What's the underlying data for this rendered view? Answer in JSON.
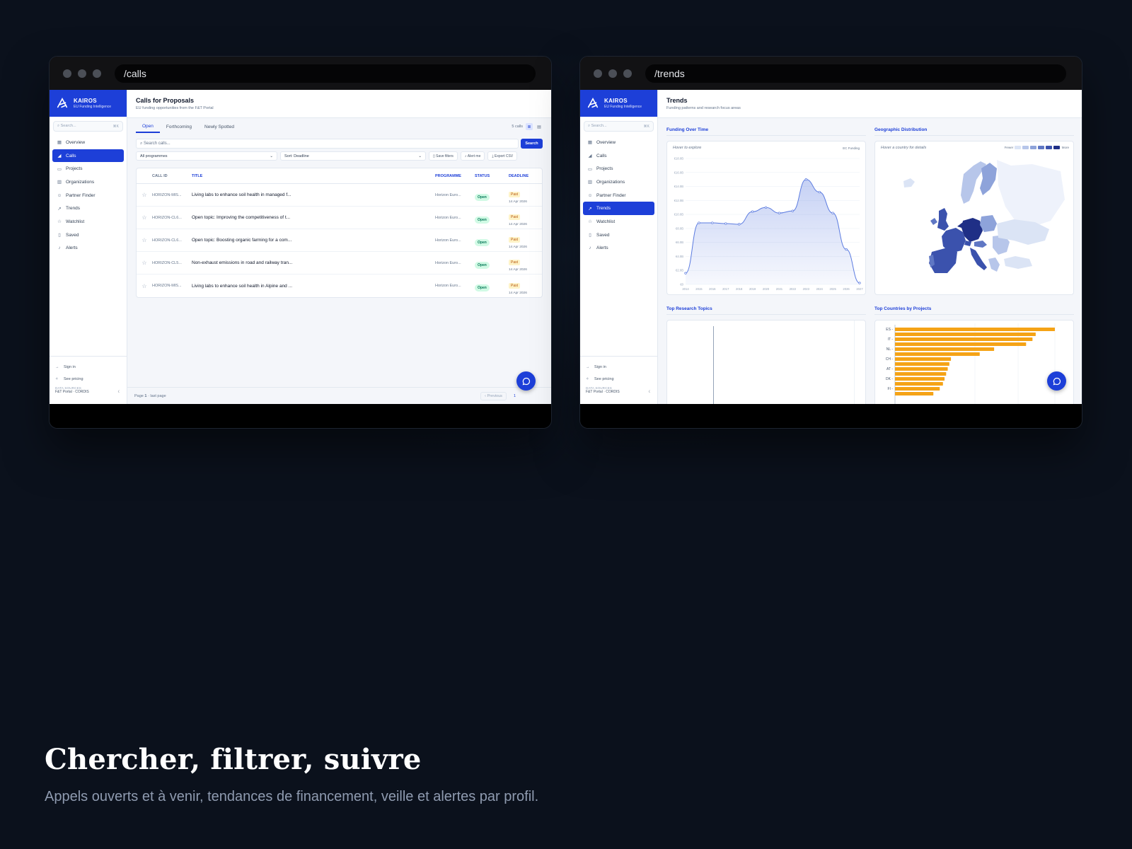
{
  "windows": {
    "calls": {
      "url": "/calls"
    },
    "trends": {
      "url": "/trends"
    }
  },
  "app": {
    "brand_name": "KAIROS",
    "brand_tagline": "EU Funding Intelligence",
    "search_placeholder": "Search...",
    "search_shortcut": "⌘K",
    "nav": [
      {
        "label": "Overview",
        "icon": "grid-icon"
      },
      {
        "label": "Calls",
        "icon": "megaphone-icon"
      },
      {
        "label": "Projects",
        "icon": "folder-icon"
      },
      {
        "label": "Organizations",
        "icon": "building-icon"
      },
      {
        "label": "Partner Finder",
        "icon": "users-icon"
      },
      {
        "label": "Trends",
        "icon": "trending-up-icon"
      },
      {
        "label": "Watchlist",
        "icon": "star-icon"
      },
      {
        "label": "Saved",
        "icon": "bookmark-icon"
      },
      {
        "label": "Alerts",
        "icon": "bell-icon"
      }
    ],
    "sign_in": "Sign in",
    "see_pricing": "See pricing",
    "data_sources_label": "DATA SOURCES",
    "data_sources_value": "F&T Portal · CORDIS",
    "accent": "#1d3fd8"
  },
  "calls_page": {
    "title": "Calls for Proposals",
    "subtitle": "EU funding opportunities from the F&T Portal",
    "tabs": [
      "Open",
      "Forthcoming",
      "Newly Spotted"
    ],
    "count": "5 calls",
    "search_placeholder": "Search calls...",
    "search_button": "Search",
    "programme_select": "All programmes",
    "sort_select": "Sort: Deadline",
    "save_filters": "Save filters",
    "alert_me": "Alert me",
    "export_csv": "Export CSV",
    "columns": [
      "CALL ID",
      "TITLE",
      "PROGRAMME",
      "STATUS",
      "DEADLINE"
    ],
    "rows": [
      {
        "id": "HORIZON-MIS...",
        "title": "Living labs to enhance soil health in managed f...",
        "programme": "Horizon Euro...",
        "status": "Open",
        "deadline_tag": "Past",
        "deadline": "14 Apr 2026"
      },
      {
        "id": "HORIZON-CL6...",
        "title": "Open topic: Improving the competitiveness of t...",
        "programme": "Horizon Euro...",
        "status": "Open",
        "deadline_tag": "Past",
        "deadline": "14 Apr 2026"
      },
      {
        "id": "HORIZON-CL6...",
        "title": "Open topic: Boosting organic farming for a com...",
        "programme": "Horizon Euro...",
        "status": "Open",
        "deadline_tag": "Past",
        "deadline": "14 Apr 2026"
      },
      {
        "id": "HORIZON-CL5...",
        "title": "Non-exhaust emissions in road and railway tran...",
        "programme": "Horizon Euro...",
        "status": "Open",
        "deadline_tag": "Past",
        "deadline": "14 Apr 2026"
      },
      {
        "id": "HORIZON-MIS...",
        "title": "Living labs to enhance soil health in Alpine and ...",
        "programme": "Horizon Euro...",
        "status": "Open",
        "deadline_tag": "Past",
        "deadline": "14 Apr 2026"
      }
    ],
    "pager_prefix": "Page",
    "pager_page": "1",
    "pager_suffix": "· last page",
    "previous": "‹ Previous",
    "page_number": "1"
  },
  "trends_page": {
    "title": "Trends",
    "subtitle": "Funding patterns and research focus areas",
    "funding_title": "Funding Over Time",
    "funding_hint": "Hover to explore",
    "funding_series_label": "EC Funding",
    "geo_title": "Geographic Distribution",
    "geo_hint": "Hover a country for details",
    "legend_fewer": "Fewer",
    "legend_more": "More",
    "legend_colors": [
      "#dbe4f5",
      "#b7c6ea",
      "#8ea3da",
      "#5f77c4",
      "#3b52ad",
      "#1f2f86"
    ],
    "topics_title": "Top Research Topics",
    "countries_title": "Top Countries by Projects"
  },
  "chart_data": [
    {
      "type": "area",
      "title": "Funding Over Time",
      "series": [
        {
          "name": "EC Funding",
          "values": [
            1.6,
            8.8,
            8.8,
            8.7,
            8.6,
            10.4,
            11.0,
            10.2,
            10.5,
            15.0,
            13.2,
            10.2,
            5.0,
            0.2
          ]
        }
      ],
      "x": [
        "2014",
        "2015",
        "2016",
        "2017",
        "2018",
        "2019",
        "2020",
        "2021",
        "2022",
        "2023",
        "2024",
        "2025",
        "2026",
        "2027"
      ],
      "y_ticks": [
        "€0",
        "€2.0B",
        "€4.0B",
        "€6.0B",
        "€8.0B",
        "€10.0B",
        "€12.0B",
        "€14.0B",
        "€16.0B",
        "€18.0B"
      ],
      "ylim": [
        0,
        18
      ],
      "color": "#5b7be0"
    },
    {
      "type": "bar",
      "title": "Top Countries by Projects",
      "orientation": "horizontal",
      "categories": [
        "ES",
        "",
        "IT",
        "",
        "NL",
        "",
        "CH",
        "",
        "AT",
        "",
        "DK",
        "",
        "FI",
        ""
      ],
      "values": [
        100,
        88,
        86,
        82,
        62,
        53,
        35,
        34,
        33,
        32,
        31,
        30,
        28,
        24
      ],
      "color": "#f5a316"
    }
  ],
  "caption": {
    "title": "Chercher, filtrer, suivre",
    "subtitle": "Appels ouverts et à venir, tendances de financement, veille et alertes par profil."
  }
}
